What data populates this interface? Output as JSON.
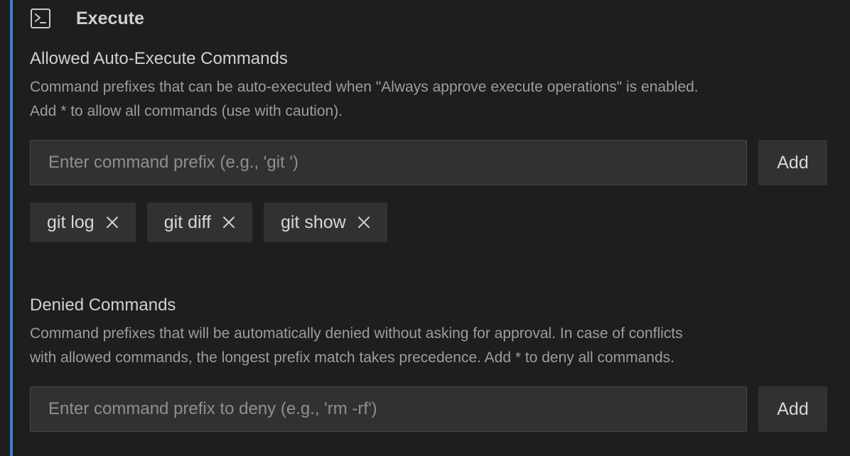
{
  "section": {
    "icon": "terminal-icon",
    "title": "Execute"
  },
  "allowed": {
    "title": "Allowed Auto-Execute Commands",
    "description_line1": "Command prefixes that can be auto-executed when \"Always approve execute operations\" is enabled.",
    "description_line2": "Add * to allow all commands (use with caution).",
    "input_placeholder": "Enter command prefix (e.g., 'git ')",
    "input_value": "",
    "add_label": "Add",
    "chips": [
      {
        "label": "git log",
        "remove_icon": "close-icon"
      },
      {
        "label": "git diff",
        "remove_icon": "close-icon"
      },
      {
        "label": "git show",
        "remove_icon": "close-icon"
      }
    ]
  },
  "denied": {
    "title": "Denied Commands",
    "description_line1": "Command prefixes that will be automatically denied without asking for approval. In case of conflicts",
    "description_line2": "with allowed commands, the longest prefix match takes precedence. Add * to deny all commands.",
    "input_placeholder": "Enter command prefix to deny (e.g., 'rm -rf')",
    "input_value": "",
    "add_label": "Add"
  },
  "colors": {
    "background": "#1e1e1e",
    "accent": "#3e7fd1",
    "control_background": "#313131",
    "text_primary": "#d0d0d0",
    "text_secondary": "#9d9d9d",
    "placeholder": "#8f8f8f"
  }
}
